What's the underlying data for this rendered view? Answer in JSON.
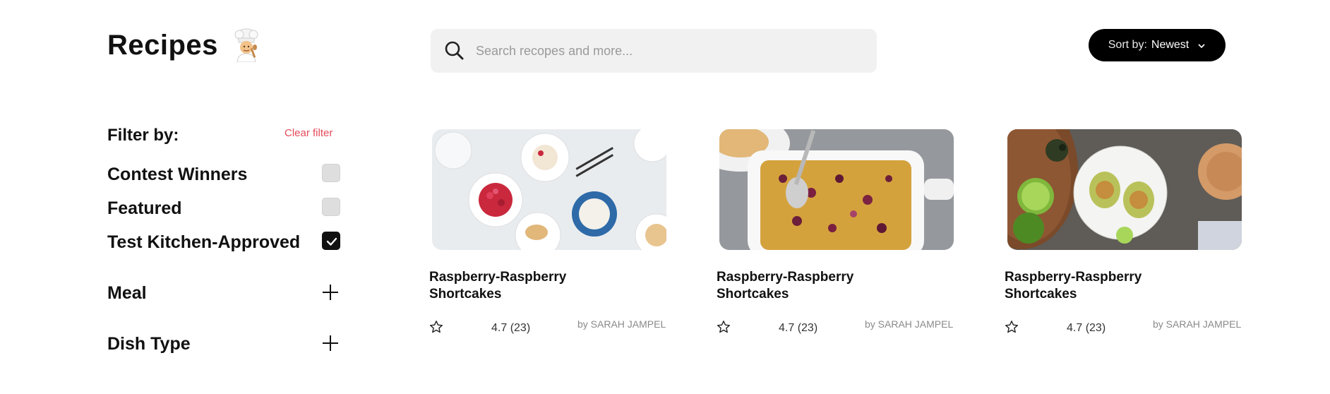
{
  "header": {
    "title": "Recipes",
    "title_icon": "chef-emoji"
  },
  "search": {
    "placeholder": "Search recopes and more...",
    "value": "",
    "icon": "search-icon"
  },
  "sort": {
    "prefix": "Sort by:",
    "value": "Newest",
    "icon": "chevron-down-icon"
  },
  "filters": {
    "heading": "Filter by:",
    "clear_label": "Clear filter",
    "clear_color": "#e34b5a",
    "options": [
      {
        "label": "Contest Winners",
        "checked": false
      },
      {
        "label": "Featured",
        "checked": false
      },
      {
        "label": "Test Kitchen-Approved",
        "checked": true
      }
    ],
    "sections": [
      {
        "label": "Meal",
        "icon": "plus-icon"
      },
      {
        "label": "Dish Type",
        "icon": "plus-icon"
      }
    ]
  },
  "recipes": [
    {
      "title_line1": "Raspberry-Raspberry",
      "title_line2": "Shortcakes",
      "rating": "4.7 (23)",
      "author": "by SARAH JAMPEL",
      "image": "raspberry shortcakes with bowls of berries and cream"
    },
    {
      "title_line1": "Raspberry-Raspberry",
      "title_line2": "Shortcakes",
      "rating": "4.7 (23)",
      "author": "by SARAH JAMPEL",
      "image": "baking dish of berry cobbler with spoon"
    },
    {
      "title_line1": "Raspberry-Raspberry",
      "title_line2": "Shortcakes",
      "rating": "4.7 (23)",
      "author": "by SARAH JAMPEL",
      "image": "halved avocados with crumb topping and limes"
    }
  ]
}
